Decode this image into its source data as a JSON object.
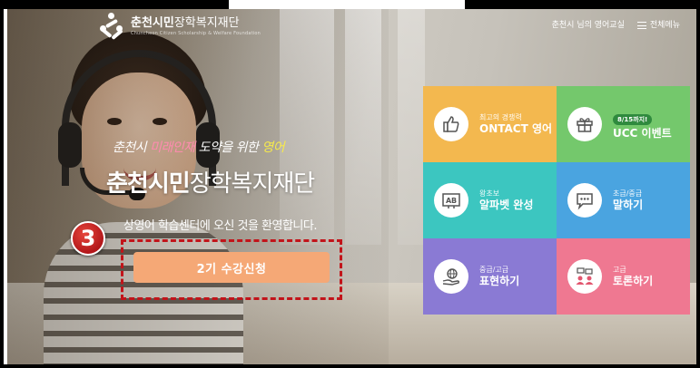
{
  "header": {
    "logo_bold": "춘천시민",
    "logo_rest": "장학복지재단",
    "logo_sub": "Chuncheon Citizen Scholarship & Welfare Foundation",
    "nav": {
      "user_link": "춘천시 님의 영어교실",
      "menu_label": "전체메뉴"
    }
  },
  "hero": {
    "tagline_part1": "춘천시 ",
    "tagline_part2": "미래인재",
    "tagline_part3": " 도약을 위한 ",
    "tagline_part4": "영어",
    "title_bold": "춘천시민",
    "title_rest": "장학복지재단",
    "welcome": "상영어 학습센터에 오신 것을 환영합니다.",
    "cta_label": "2기 수강신청"
  },
  "annotation": {
    "step_number": "3",
    "highlight_color": "#c2141a"
  },
  "tiles": [
    {
      "sub": "최고의 경쟁력",
      "main": "ONTACT 영어",
      "color": "#f3b84f",
      "icon": "thumbs-up-icon"
    },
    {
      "pill": "8/15까지!",
      "main": "UCC 이벤트",
      "color": "#74c86c",
      "icon": "gift-icon"
    },
    {
      "sub": "왕초보",
      "main": "알파벳 완성",
      "color": "#3cc6c0",
      "icon": "alphabet-icon"
    },
    {
      "sub": "초급/중급",
      "main": "말하기",
      "color": "#4aa4e0",
      "icon": "speech-bubble-icon"
    },
    {
      "sub": "중급/고급",
      "main": "표현하기",
      "color": "#8a7ad4",
      "icon": "globe-hand-icon"
    },
    {
      "sub": "고급",
      "main": "토론하기",
      "color": "#ef7891",
      "icon": "discussion-icon"
    }
  ]
}
